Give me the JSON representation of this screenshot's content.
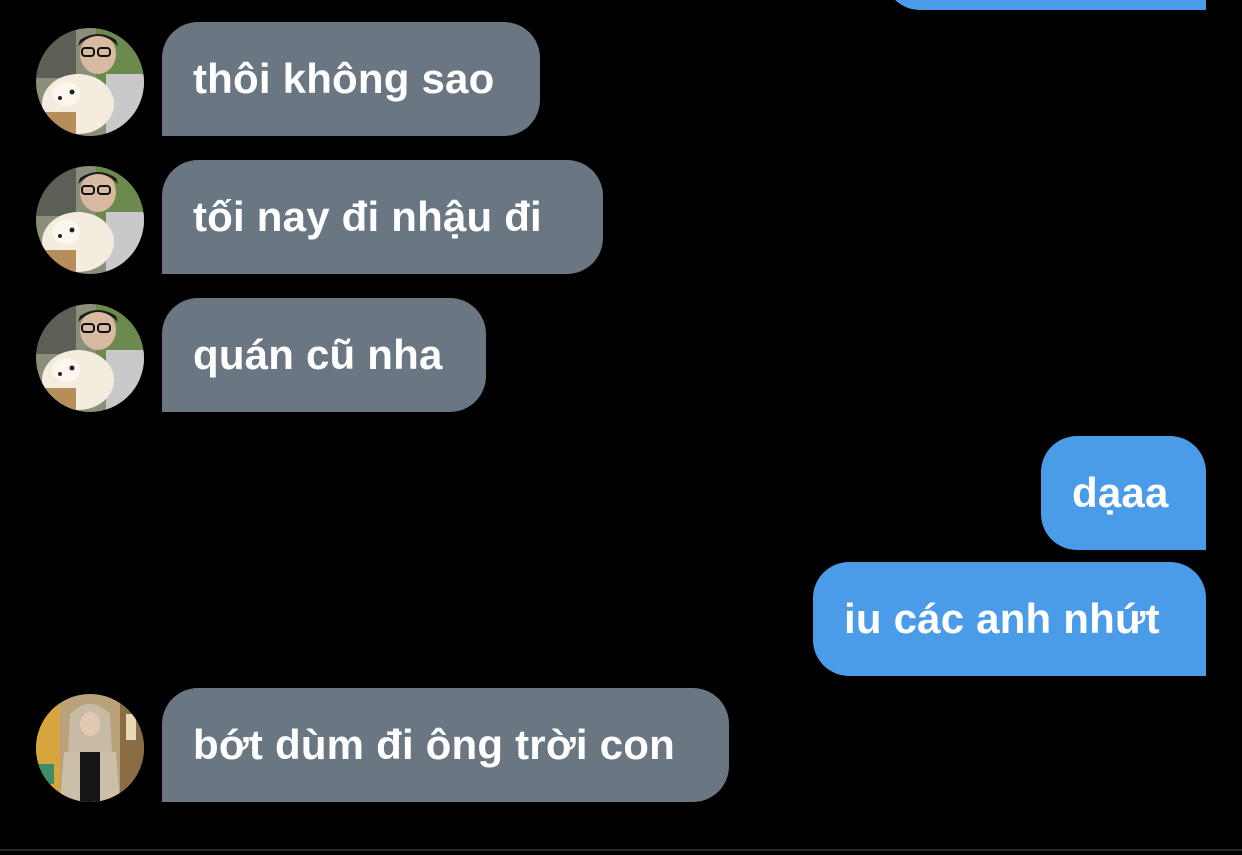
{
  "colors": {
    "background": "#000000",
    "incoming_bubble": "#6a7682",
    "outgoing_bubble": "#4a9be8",
    "text": "#ffffff"
  },
  "messages": [
    {
      "direction": "outgoing",
      "text": ""
    },
    {
      "direction": "incoming",
      "sender_avatar": "avatar-guy-with-dog",
      "text": "thôi không sao"
    },
    {
      "direction": "incoming",
      "sender_avatar": "avatar-guy-with-dog",
      "text": "tối nay đi nhậu đi"
    },
    {
      "direction": "incoming",
      "sender_avatar": "avatar-guy-with-dog",
      "text": "quán cũ nha"
    },
    {
      "direction": "outgoing",
      "text": "dạaa"
    },
    {
      "direction": "outgoing",
      "text": "iu các anh nhứt"
    },
    {
      "direction": "incoming",
      "sender_avatar": "avatar-hoodie-person",
      "text": "bớt dùm đi ông trời con"
    }
  ]
}
